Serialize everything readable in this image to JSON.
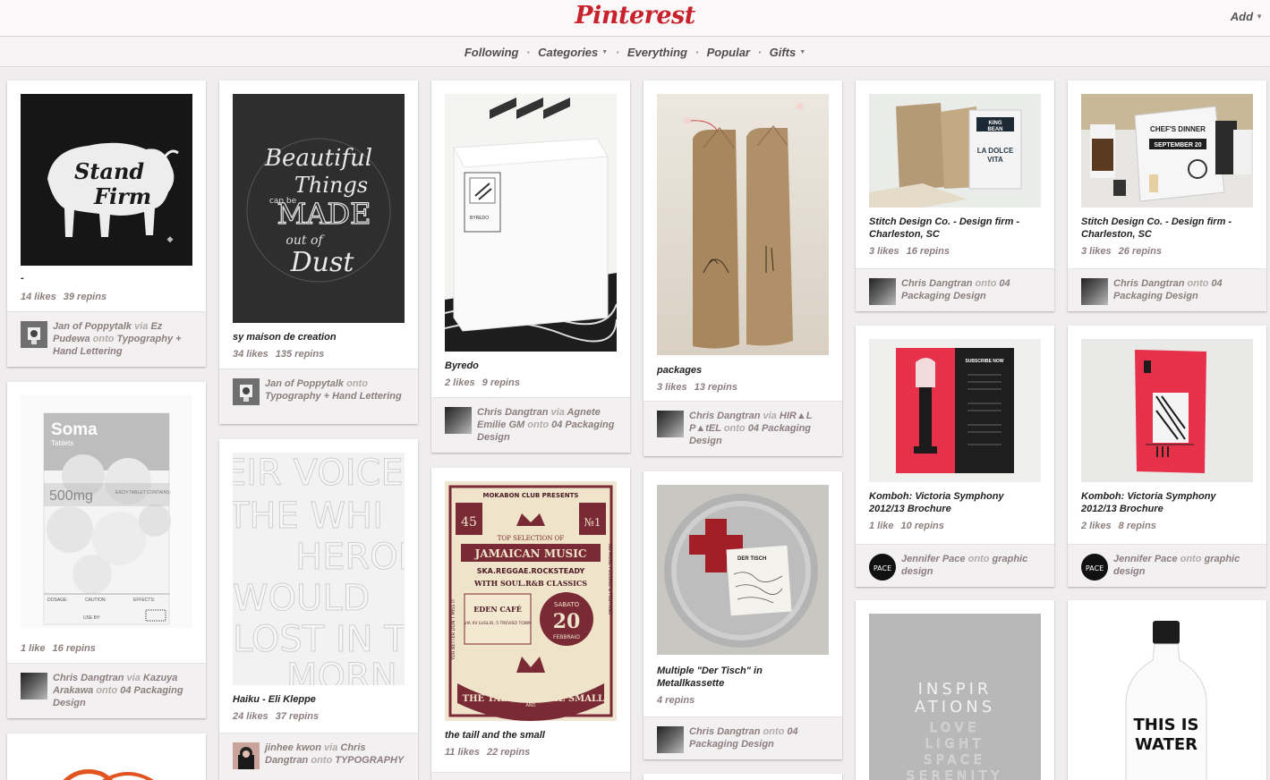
{
  "header": {
    "logo": "Pinterest",
    "add_label": "Add",
    "nav": [
      {
        "label": "Following",
        "caret": false
      },
      {
        "label": "Categories",
        "caret": true
      },
      {
        "label": "Everything",
        "caret": false
      },
      {
        "label": "Popular",
        "caret": false
      },
      {
        "label": "Gifts",
        "caret": true
      }
    ],
    "nav_sep": "·",
    "caret_glyph": "▼"
  },
  "pins": [
    {
      "title": "-",
      "likes": "14 likes",
      "repins": "39 repins",
      "attr": {
        "name": "Jan of Poppytalk",
        "via": "via",
        "source": "Ez Pudewa",
        "onto": "onto",
        "board": "Typography + Hand Lettering"
      }
    },
    {
      "title": "sy maison de creation",
      "likes": "34 likes",
      "repins": "135 repins",
      "attr": {
        "name": "Jan of Poppytalk",
        "onto": "onto",
        "board": "Typography + Hand Lettering"
      }
    },
    {
      "title": "Byredo",
      "likes": "2 likes",
      "repins": "9 repins",
      "attr": {
        "name": "Chris Dangtran",
        "via": "via",
        "source": "Agnete Emilie GM",
        "onto": "onto",
        "board": "04 Packaging Design"
      }
    },
    {
      "title": "packages",
      "likes": "3 likes",
      "repins": "13 repins",
      "attr": {
        "name": "Chris Dangtran",
        "via": "via",
        "source": "HIR▲L P▲tEL",
        "onto": "onto",
        "board": "04 Packaging Design"
      }
    },
    {
      "title": "Stitch Design Co. - Design firm - Charleston, SC",
      "likes": "3 likes",
      "repins": "16 repins",
      "attr": {
        "name": "Chris Dangtran",
        "onto": "onto",
        "board": "04 Packaging Design"
      }
    },
    {
      "title": "Stitch Design Co. - Design firm - Charleston, SC",
      "likes": "3 likes",
      "repins": "26 repins",
      "attr": {
        "name": "Chris Dangtran",
        "onto": "onto",
        "board": "04 Packaging Design"
      }
    },
    {
      "title": "",
      "likes": "1 like",
      "repins": "16 repins",
      "attr": {
        "name": "Chris Dangtran",
        "via": "via",
        "source": "Kazuya Arakawa",
        "onto": "onto",
        "board": "04 Packaging Design"
      }
    },
    {
      "title": "Haiku - Eli Kleppe",
      "likes": "24 likes",
      "repins": "37 repins",
      "attr": {
        "name": "jinhee kwon",
        "via": "via",
        "source": "Chris Dangtran",
        "onto": "onto",
        "board": "TYPOGRAPHY"
      }
    },
    {
      "title": "the taill and the small",
      "likes": "11 likes",
      "repins": "22 repins"
    },
    {
      "title": "Multiple \"Der Tisch\" in Metallkassette",
      "likes": "",
      "repins": "4 repins",
      "attr": {
        "name": "Chris Dangtran",
        "onto": "onto",
        "board": "04 Packaging Design"
      }
    },
    {
      "title": "Komboh: Victoria Symphony 2012/13 Brochure",
      "likes": "1 like",
      "repins": "10 repins",
      "attr": {
        "name": "Jennifer Pace",
        "onto": "onto",
        "board": "graphic design"
      }
    },
    {
      "title": "Komboh: Victoria Symphony 2012/13 Brochure",
      "likes": "2 likes",
      "repins": "8 repins",
      "attr": {
        "name": "Jennifer Pace",
        "onto": "onto",
        "board": "graphic design"
      }
    },
    {
      "title": "",
      "likes": "",
      "repins": ""
    },
    {
      "title": "",
      "likes": "",
      "repins": ""
    }
  ],
  "art_text": {
    "bison": [
      "Stand",
      "Firm"
    ],
    "chalk": [
      "Beautiful",
      "Things",
      "can be",
      "MADE",
      "out of",
      "Dust"
    ],
    "box_label": "BYREDO",
    "coffee_labels": [
      "KING",
      "BEAN",
      "LA DOLCE",
      "VITA"
    ],
    "dinner_labels": [
      "CHEF'S DINNER",
      "SEPTEMBER 20"
    ],
    "soma": {
      "brand": "Soma",
      "sub": "Tablets",
      "dose": "500mg",
      "contains": "EACH TABLET CONTAINS:",
      "dosage": "DOSAGE:",
      "caution": "CAUTION:",
      "effects": "EFFECTS:",
      "useby": "USE BY:"
    },
    "emboss": [
      "EIR VOICE",
      "THE WHI",
      "HERON",
      "WOULD",
      "LOST IN T",
      "MORN"
    ],
    "poster": {
      "top": "MOKABON CLUB PRESENTS",
      "num_left": "45",
      "num_right": "№1",
      "sel": "TOP SELECTION OF",
      "music": "JAMAICAN MUSIC",
      "genres": "SKA.REGGAE.ROCKSTEADY",
      "with": "WITH SOUL.R&B CLASSICS",
      "cafe": "EDEN CAFÉ",
      "cafe_sub": "VIA XV LUGLIO, 5 TREVISO TOWN",
      "day": "SABATO",
      "date": "20",
      "month": "FEBBRAIO",
      "tall": "THE TALL",
      "and": "AND",
      "small": "THE SMALL",
      "side_left": "YOU BETTER DON'T MISS IT",
      "side_right": "NO MORE FUSSING & FIGHTING"
    },
    "tin_label": "DER TISCH",
    "brochure": "SUBSCRIBE NOW",
    "inspir": [
      "INSPIR",
      "ATIONS",
      "LOVE",
      "LIGHT",
      "SPACE",
      "SERENITY"
    ],
    "water": [
      "THIS IS",
      "WATER"
    ],
    "pace": "PACE"
  },
  "colors": {
    "brand": "#c8232c",
    "background": "#efeded"
  }
}
